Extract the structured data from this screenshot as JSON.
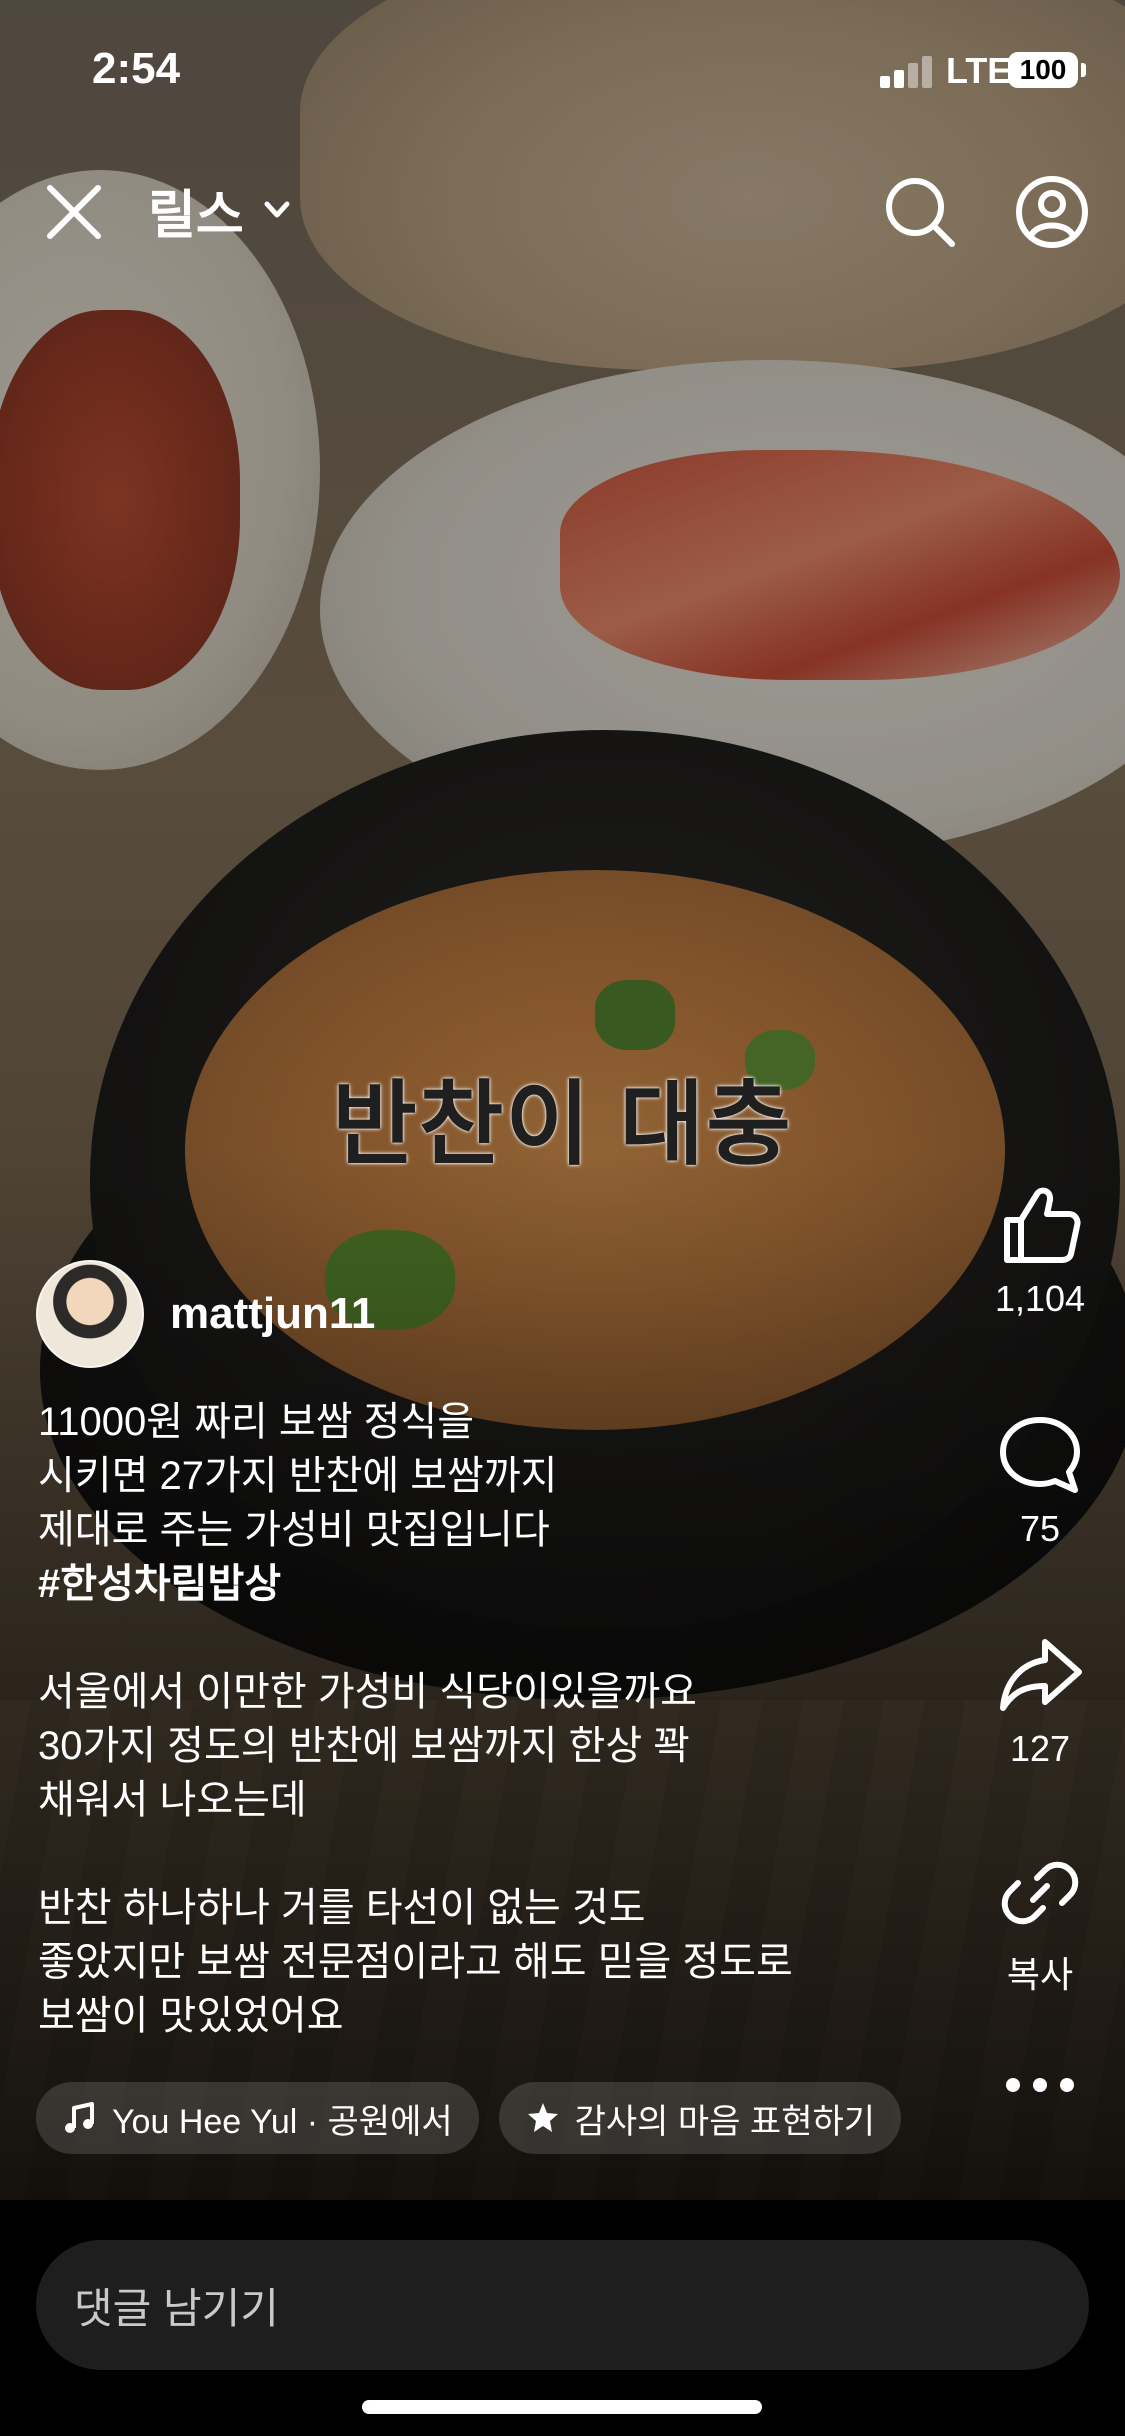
{
  "status_bar": {
    "time": "2:54",
    "network": "LTE",
    "battery": "100"
  },
  "header": {
    "title": "릴스",
    "icons": [
      "close-icon",
      "chevron-down-icon",
      "search-icon",
      "profile-icon"
    ]
  },
  "video": {
    "overlay_text": "반찬이 대충"
  },
  "post": {
    "username": "mattjun11",
    "caption_lines_1": "11000원 짜리 보쌈 정식을\n시키면 27가지 반찬에 보쌈까지\n제대로 주는 가성비 맛집입니다",
    "hashtag": "#한성차림밥상",
    "caption_lines_2": "서울에서 이만한 가성비 식당이있을까요\n30가지 정도의 반찬에 보쌈까지 한상 꽉\n채워서 나오는데",
    "caption_lines_3": "반찬 하나하나 거를 타선이 없는 것도\n좋았지만 보쌈 전문점이라고 해도 믿을 정도로\n보쌈이 맛있었어요"
  },
  "actions": {
    "likes": "1,104",
    "comments": "75",
    "shares": "127",
    "copy_label": "복사"
  },
  "chips": {
    "music": "You Hee Yul · 공원에서",
    "thanks": "감사의 마음 표현하기"
  },
  "comment_bar": {
    "placeholder": "댓글 남기기"
  },
  "colors": {
    "background": "#000000",
    "text": "#ffffff",
    "input_bg": "#1e1e1e"
  }
}
